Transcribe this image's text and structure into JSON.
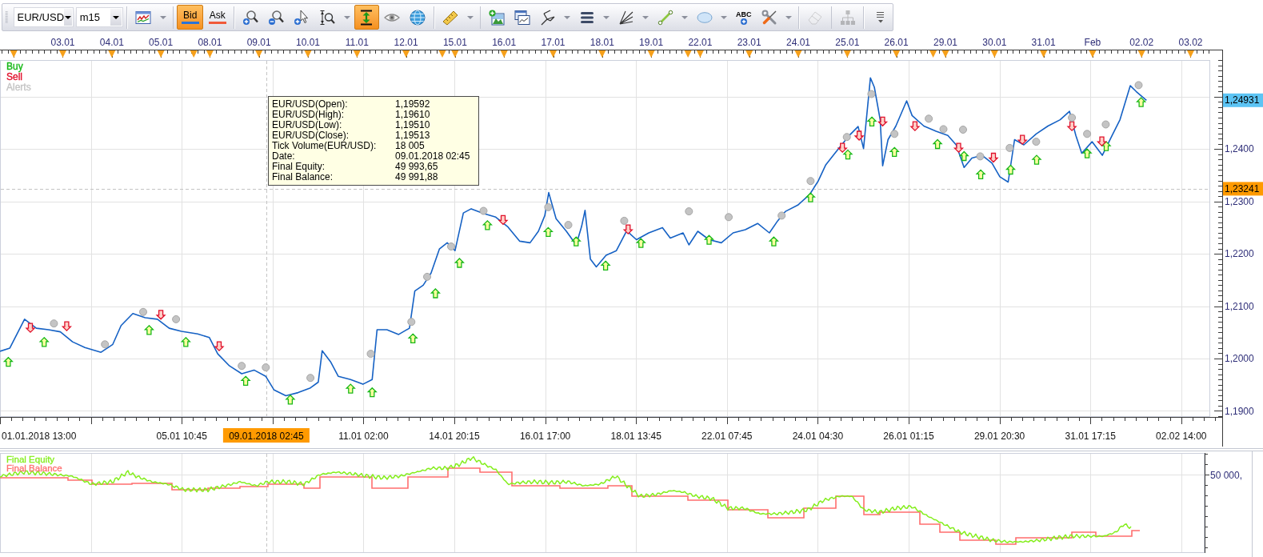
{
  "toolbar": {
    "symbol": "EUR/USD",
    "timeframe": "m15",
    "tool_groups": [
      [
        {
          "kind": "chart-type",
          "on": false,
          "disabled": false,
          "dropdown": true
        }
      ],
      [
        {
          "kind": "price",
          "label": "Bid",
          "color": "#2a74d8",
          "on": true,
          "disabled": false,
          "dropdown": false
        },
        {
          "kind": "price",
          "label": "Ask",
          "color": "#f05a3a",
          "on": false,
          "disabled": false,
          "dropdown": false
        }
      ],
      [
        {
          "kind": "zoom-in",
          "on": false,
          "disabled": false,
          "dropdown": false
        },
        {
          "kind": "zoom-out",
          "on": false,
          "disabled": false,
          "dropdown": false
        },
        {
          "kind": "cursor-zoom",
          "on": false,
          "disabled": false,
          "dropdown": false
        },
        {
          "kind": "zoom-range",
          "on": false,
          "disabled": false,
          "dropdown": true
        },
        {
          "kind": "auto-scale",
          "on": true,
          "disabled": false,
          "dropdown": false
        },
        {
          "kind": "eye",
          "on": false,
          "disabled": false,
          "dropdown": false
        },
        {
          "kind": "globe",
          "on": false,
          "disabled": false,
          "dropdown": false
        }
      ],
      [
        {
          "kind": "ruler",
          "on": false,
          "disabled": false,
          "dropdown": true
        }
      ],
      [
        {
          "kind": "image",
          "on": false,
          "disabled": false,
          "dropdown": false
        },
        {
          "kind": "window",
          "on": false,
          "disabled": false,
          "dropdown": false
        },
        {
          "kind": "pitchfork",
          "on": false,
          "disabled": false,
          "dropdown": true
        },
        {
          "kind": "lines",
          "on": false,
          "disabled": false,
          "dropdown": true
        },
        {
          "kind": "fan",
          "on": false,
          "disabled": false,
          "dropdown": true
        },
        {
          "kind": "line",
          "on": false,
          "disabled": false,
          "dropdown": true
        },
        {
          "kind": "ellipse",
          "on": false,
          "disabled": false,
          "dropdown": true
        },
        {
          "kind": "text",
          "label": "ABC",
          "on": false,
          "disabled": false,
          "dropdown": false
        },
        {
          "kind": "tools",
          "on": false,
          "disabled": false,
          "dropdown": true
        }
      ],
      [
        {
          "kind": "eraser",
          "on": false,
          "disabled": true,
          "dropdown": false
        }
      ],
      [
        {
          "kind": "hierarchy",
          "on": false,
          "disabled": true,
          "dropdown": false
        }
      ],
      [
        {
          "kind": "more",
          "on": false,
          "disabled": false,
          "dropdown": false
        }
      ]
    ]
  },
  "chart": {
    "top_axis": [
      "03.01",
      "04.01",
      "05.01",
      "08.01",
      "09.01",
      "10.01",
      "11.01",
      "12.01",
      "15.01",
      "16.01",
      "17.01",
      "18.01",
      "19.01",
      "22.01",
      "23.01",
      "24.01",
      "25.01",
      "26.01",
      "29.01",
      "30.01",
      "31.01",
      "Feb",
      "02.02",
      "03.02"
    ],
    "legend": [
      {
        "label": "Buy",
        "color": "#18b818"
      },
      {
        "label": "Sell",
        "color": "#e0102a"
      },
      {
        "label": "Alerts",
        "color": "#c4c4c4"
      }
    ],
    "tooltip": {
      "rows": [
        {
          "label": "EUR/USD(Open):",
          "value": "1,19592"
        },
        {
          "label": "EUR/USD(High):",
          "value": "1,19610"
        },
        {
          "label": "EUR/USD(Low):",
          "value": "1,19510"
        },
        {
          "label": "EUR/USD(Close):",
          "value": "1,19513"
        },
        {
          "label": "Tick Volume(EUR/USD):",
          "value": "18 005"
        },
        {
          "label": "Date:",
          "value": "09.01.2018 02:45"
        },
        {
          "label": "Final Equity:",
          "value": "49 993,65"
        },
        {
          "label": "Final Balance:",
          "value": "49 991,88"
        }
      ]
    },
    "last_price": "1,24931",
    "cursor_price": "1,23241",
    "price_axis": [
      "1,2400",
      "1,2300",
      "1,2200",
      "1,2100",
      "1,2000",
      "1,1900"
    ],
    "time_axis": [
      "01.01.2018 13:00",
      "05.01 10:45",
      "11.01 02:00",
      "14.01 20:15",
      "16.01 17:00",
      "18.01 13:45",
      "22.01 07:45",
      "24.01 04:30",
      "26.01 01:15",
      "29.01 20:30",
      "31.01 17:15",
      "02.02 14:00"
    ],
    "cursor_time": "09.01.2018 02:45"
  },
  "equity_panel": {
    "legend": [
      {
        "label": "Final Equity",
        "color": "#84ee1c"
      },
      {
        "label": "Final Balance",
        "color": "#ff6e6e"
      }
    ],
    "axis_label": "50 000,"
  }
}
